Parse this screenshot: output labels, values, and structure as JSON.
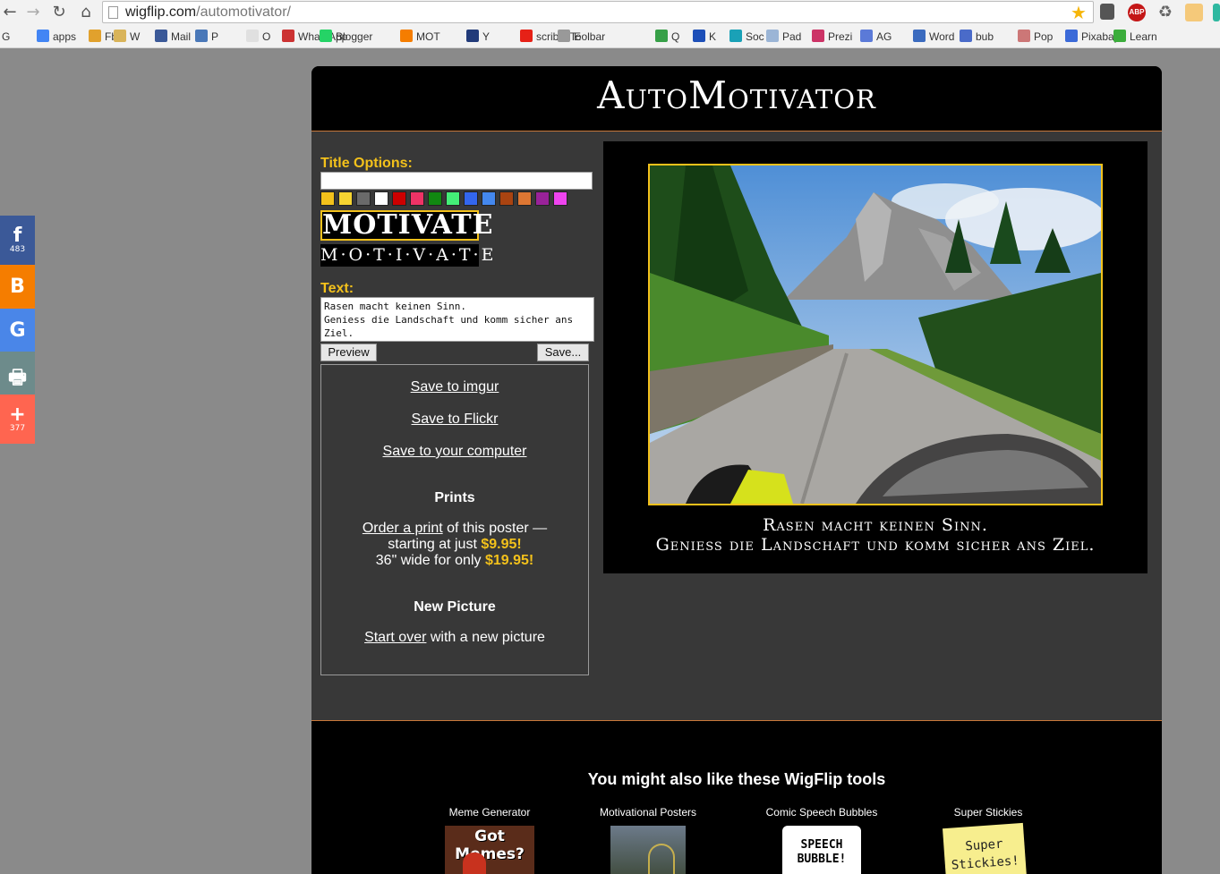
{
  "browser": {
    "url_host": "wigflip.com",
    "url_path": "/automotivator/",
    "bookmarks": [
      "G",
      "apps",
      "Fb",
      "W",
      "Mail",
      "P",
      "O",
      "WhatsApp",
      "Blogger",
      "MOT",
      "Y",
      "scrible Toolbar",
      "E",
      "Q",
      "K",
      "Soc",
      "Pad",
      "Prezi",
      "AG",
      "Word",
      "bub",
      "Pop",
      "Pixabay",
      "Learn"
    ],
    "ext_badge": "ABP",
    "ext_badge_count": "2"
  },
  "social": [
    {
      "icon": "facebook-icon",
      "glyph": "f",
      "count": "483",
      "color": "#3b5998"
    },
    {
      "icon": "blogger-icon",
      "glyph": "B",
      "count": "",
      "color": "#f57d00"
    },
    {
      "icon": "google-icon",
      "glyph": "G",
      "count": "",
      "color": "#4a86e8"
    },
    {
      "icon": "print-icon",
      "glyph": "🖶",
      "count": "",
      "color": "#6d8b8b"
    },
    {
      "icon": "plus-icon",
      "glyph": "+",
      "count": "377",
      "color": "#ff6550"
    }
  ],
  "site": {
    "title": "AutoMotivator"
  },
  "editor": {
    "title_options_label": "Title Options:",
    "title_value": "",
    "swatches": [
      "#f3c11b",
      "#f6d431",
      "#6a6a6a",
      "#ffffff",
      "#cc0000",
      "#ee3366",
      "#118811",
      "#44ee77",
      "#3366ee",
      "#4488ee",
      "#aa4411",
      "#dd7733",
      "#992299",
      "#ee44ee"
    ],
    "style_a": "MOTIVATE",
    "style_b": "M·O·T·I·V·A·T·E",
    "text_label": "Text:",
    "text_value": "Rasen macht keinen Sinn.\nGeniess die Landschaft und komm sicher ans Ziel.",
    "preview_label": "Preview",
    "save_label": "Save..."
  },
  "save_box": {
    "imgur": "Save to imgur",
    "flickr": "Save to Flickr",
    "computer": "Save to your computer",
    "prints_heading": "Prints",
    "order_link": "Order a print",
    "order_rest": " of this poster —",
    "starting_text": "starting at just ",
    "starting_price": "$9.95!",
    "wide_text": "36\" wide for only ",
    "wide_price": "$19.95!",
    "new_heading": "New Picture",
    "start_link": "Start over",
    "start_rest": " with a new picture"
  },
  "poster": {
    "line1": "Rasen macht keinen Sinn.",
    "line2": "Geniess die Landschaft und komm sicher ans Ziel."
  },
  "footer": {
    "title": "You might also like these WigFlip tools",
    "tools": [
      "Meme Generator",
      "Motivational Posters",
      "Comic Speech Bubbles",
      "Super Stickies"
    ],
    "meme_thumb_text": "Got Memes?",
    "bubble_thumb_text_1": "SPEECH",
    "bubble_thumb_text_2": "BUBBLE!",
    "sticky_thumb_text_1": "Super",
    "sticky_thumb_text_2": "Stickies!"
  }
}
